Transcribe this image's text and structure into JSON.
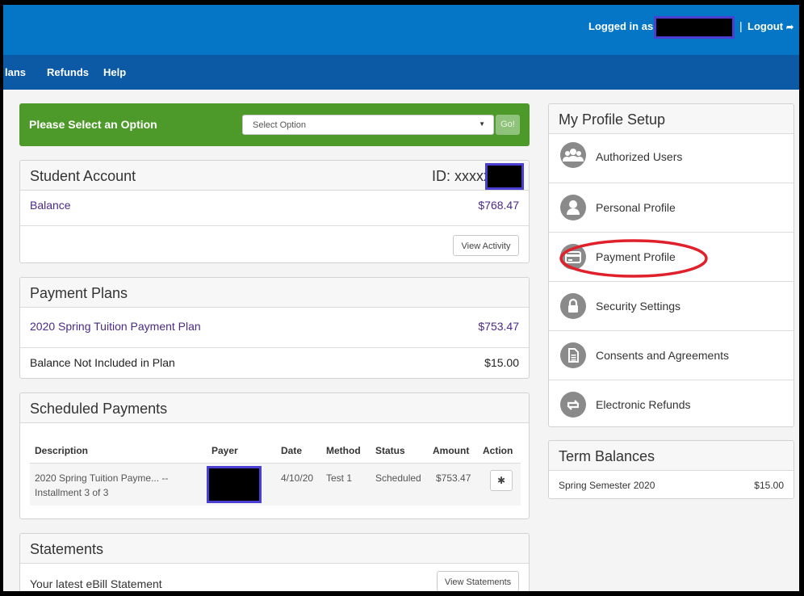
{
  "header": {
    "logged_in_label": "Logged in as:",
    "logout_label": "Logout"
  },
  "nav": {
    "items": [
      {
        "label": "lans"
      },
      {
        "label": "Refunds"
      },
      {
        "label": "Help"
      }
    ]
  },
  "option_bar": {
    "label": "Please Select an Option",
    "select_value": "Select Option",
    "go_label": "Go!"
  },
  "student_account": {
    "title": "Student Account",
    "id_label": "ID: xxxxx",
    "balance_label": "Balance",
    "balance_value": "$768.47",
    "view_activity_label": "View Activity"
  },
  "payment_plans": {
    "title": "Payment Plans",
    "plan_label": "2020 Spring Tuition Payment Plan",
    "plan_value": "$753.47",
    "not_included_label": "Balance Not Included in Plan",
    "not_included_value": "$15.00"
  },
  "scheduled_payments": {
    "title": "Scheduled Payments",
    "columns": [
      "Description",
      "Payer",
      "Date",
      "Method",
      "Status",
      "Amount",
      "Action"
    ],
    "rows": [
      {
        "description_line1": "2020 Spring Tuition Payme... --",
        "description_line2": "Installment 3 of 3",
        "date": "4/10/20",
        "method": "Test 1",
        "status": "Scheduled",
        "amount": "$753.47"
      }
    ]
  },
  "statements": {
    "title": "Statements",
    "latest_label": "Your latest eBill Statement",
    "view_label": "View Statements"
  },
  "profile": {
    "title": "My Profile Setup",
    "items": [
      {
        "label": "Authorized Users",
        "icon": "users-icon"
      },
      {
        "label": "Personal Profile",
        "icon": "person-icon"
      },
      {
        "label": "Payment Profile",
        "icon": "credit-card-icon"
      },
      {
        "label": "Security Settings",
        "icon": "lock-icon"
      },
      {
        "label": "Consents and Agreements",
        "icon": "document-icon"
      },
      {
        "label": "Electronic Refunds",
        "icon": "refresh-icon"
      }
    ]
  },
  "term_balances": {
    "title": "Term Balances",
    "term_label": "Spring Semester 2020",
    "term_value": "$15.00"
  },
  "colors": {
    "header": "#0576c6",
    "nav": "#0c5aa6",
    "option_bar": "#4d9a2a",
    "link": "#4b2a86",
    "annotation": "#e0202a",
    "redaction_border": "#4a3fd0"
  }
}
